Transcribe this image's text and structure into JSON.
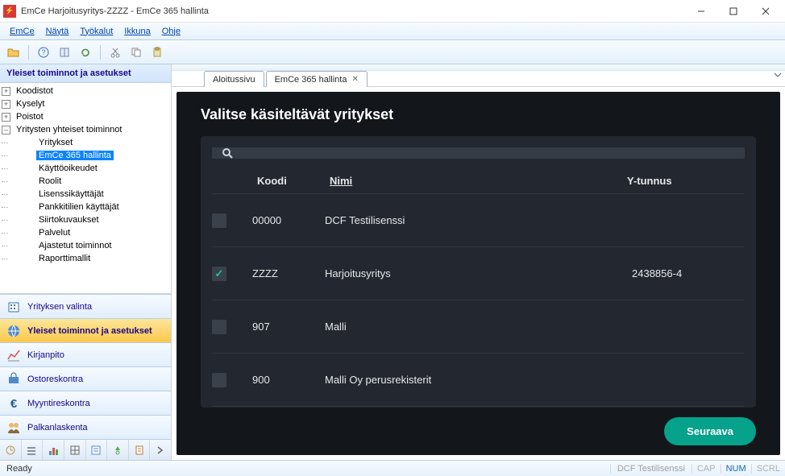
{
  "window": {
    "title": "EmCe  Harjoitusyritys-ZZZZ - EmCe 365 hallinta",
    "icon_text": "⚡"
  },
  "menu": {
    "emce": "EmCe",
    "nayta": "Näytä",
    "tyokalut": "Työkalut",
    "ikkuna": "Ikkuna",
    "ohje": "Ohje"
  },
  "sidebar": {
    "header": "Yleiset toiminnot ja asetukset",
    "tree": [
      {
        "label": "Koodistot",
        "depth": 0,
        "exp": "+"
      },
      {
        "label": "Kyselyt",
        "depth": 0,
        "exp": "+"
      },
      {
        "label": "Poistot",
        "depth": 0,
        "exp": "+"
      },
      {
        "label": "Yritysten yhteiset toiminnot",
        "depth": 0,
        "exp": "–"
      },
      {
        "label": "Yritykset",
        "depth": 1,
        "exp": ""
      },
      {
        "label": "EmCe 365 hallinta",
        "depth": 1,
        "exp": "",
        "selected": true
      },
      {
        "label": "Käyttöoikeudet",
        "depth": 1,
        "exp": ""
      },
      {
        "label": "Roolit",
        "depth": 1,
        "exp": ""
      },
      {
        "label": "Lisenssikäyttäjät",
        "depth": 1,
        "exp": ""
      },
      {
        "label": "Pankkitilien käyttäjät",
        "depth": 1,
        "exp": ""
      },
      {
        "label": "Siirtokuvaukset",
        "depth": 1,
        "exp": ""
      },
      {
        "label": "Palvelut",
        "depth": 1,
        "exp": ""
      },
      {
        "label": "Ajastetut toiminnot",
        "depth": 1,
        "exp": ""
      },
      {
        "label": "Raporttimallit",
        "depth": 1,
        "exp": ""
      }
    ],
    "nav": [
      {
        "label": "Yrityksen valinta",
        "icon": "company"
      },
      {
        "label": "Yleiset toiminnot ja asetukset",
        "icon": "globe",
        "active": true
      },
      {
        "label": "Kirjanpito",
        "icon": "chart"
      },
      {
        "label": "Ostoreskontra",
        "icon": "buy"
      },
      {
        "label": "Myyntireskontra",
        "icon": "euro"
      },
      {
        "label": "Palkanlaskenta",
        "icon": "people"
      }
    ]
  },
  "tabs": [
    {
      "label": "Aloitussivu",
      "closable": false
    },
    {
      "label": "EmCe 365 hallinta",
      "closable": true
    }
  ],
  "panel": {
    "title": "Valitse käsiteltävät yritykset",
    "headers": {
      "code": "Koodi",
      "name": "Nimi",
      "vat": "Y-tunnus"
    },
    "rows": [
      {
        "checked": false,
        "code": "00000",
        "name": "DCF Testilisenssi",
        "vat": ""
      },
      {
        "checked": true,
        "code": "ZZZZ",
        "name": "Harjoitusyritys",
        "vat": "2438856-4"
      },
      {
        "checked": false,
        "code": "907",
        "name": "Malli",
        "vat": ""
      },
      {
        "checked": false,
        "code": "900",
        "name": "Malli Oy perusrekisterit",
        "vat": ""
      }
    ],
    "button": "Seuraava"
  },
  "status": {
    "left": "Ready",
    "mid": "DCF Testilisenssi",
    "cap": "CAP",
    "num": "NUM",
    "scrl": "SCRL"
  }
}
